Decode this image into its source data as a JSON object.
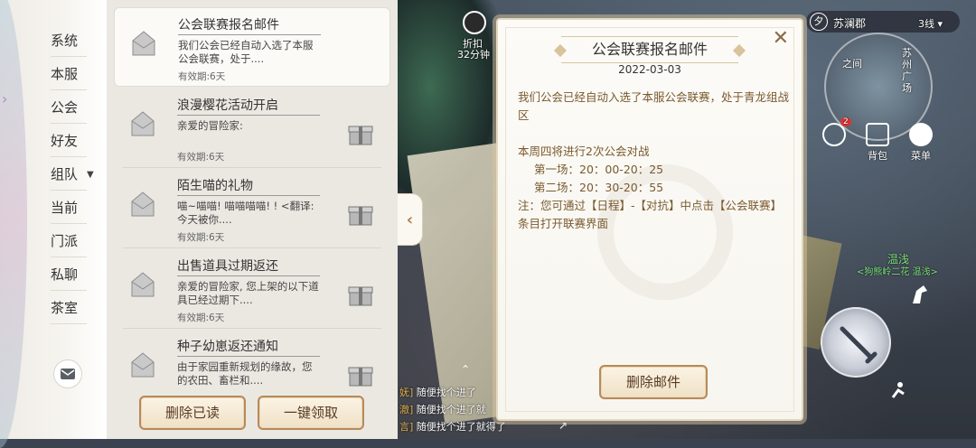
{
  "rail": {
    "items": [
      {
        "label": "系统"
      },
      {
        "label": "本服"
      },
      {
        "label": "公会"
      },
      {
        "label": "好友"
      },
      {
        "label": "组队"
      },
      {
        "label": "当前"
      },
      {
        "label": "门派"
      },
      {
        "label": "私聊"
      },
      {
        "label": "茶室"
      }
    ]
  },
  "mails": [
    {
      "title": "公会联赛报名邮件",
      "body": "我们公会已经自动入选了本服公会联赛，处于....",
      "expire": "有效期:6天",
      "has_gift": false,
      "selected": true
    },
    {
      "title": "浪漫樱花活动开启",
      "body": "亲爱的冒险家:",
      "expire": "有效期:6天",
      "has_gift": true,
      "selected": false
    },
    {
      "title": "陌生喵的礼物",
      "body": "喵~喵喵! 喵喵喵喵! ! <翻译: 今天被你....",
      "expire": "有效期:6天",
      "has_gift": true,
      "selected": false
    },
    {
      "title": "出售道具过期返还",
      "body": "亲爱的冒险家, 您上架的以下道具已经过期下....",
      "expire": "有效期:6天",
      "has_gift": true,
      "selected": false
    },
    {
      "title": "种子幼崽返还通知",
      "body": "由于家园重新规划的缘故，您的农田、畜栏和....",
      "expire": "",
      "has_gift": true,
      "selected": false
    }
  ],
  "list_actions": {
    "delete_read": "删除已读",
    "claim_all": "一键领取"
  },
  "detail": {
    "title": "公会联赛报名邮件",
    "date": "2022-03-03",
    "para1": "我们公会已经自动入选了本服公会联赛，处于青龙组战区",
    "para2": "本周四将进行2次公会对战",
    "match1": "第一场：20：00-20：25",
    "match2": "第二场：20：30-20：55",
    "note": "注：您可通过【日程】-【对抗】中点击【公会联赛】条目打开联赛界面",
    "delete_button": "删除邮件",
    "close": "✕"
  },
  "hud": {
    "player_mark": "夕",
    "location": "苏澜郡",
    "line": "3线",
    "discount_label": "折扣",
    "discount_time": "32分钟",
    "badge_count": "2",
    "bag_label": "背包",
    "menu_label": "菜单",
    "npc_name": "温浅",
    "npc_guild": "<狗熊岭二花 温浅>",
    "map_area": "苏州广场",
    "map_area2": "之间"
  },
  "chat": [
    {
      "tag": "妩]",
      "text": "随便找个进了"
    },
    {
      "tag": "澈]",
      "text": "随便找个进了就"
    },
    {
      "tag": "言]",
      "text": "随便找个进了就得了"
    }
  ],
  "colors": {
    "accent_gold": "#b88a58",
    "detail_text": "#7a5a2e",
    "list_bg": "#ebe8e2"
  }
}
